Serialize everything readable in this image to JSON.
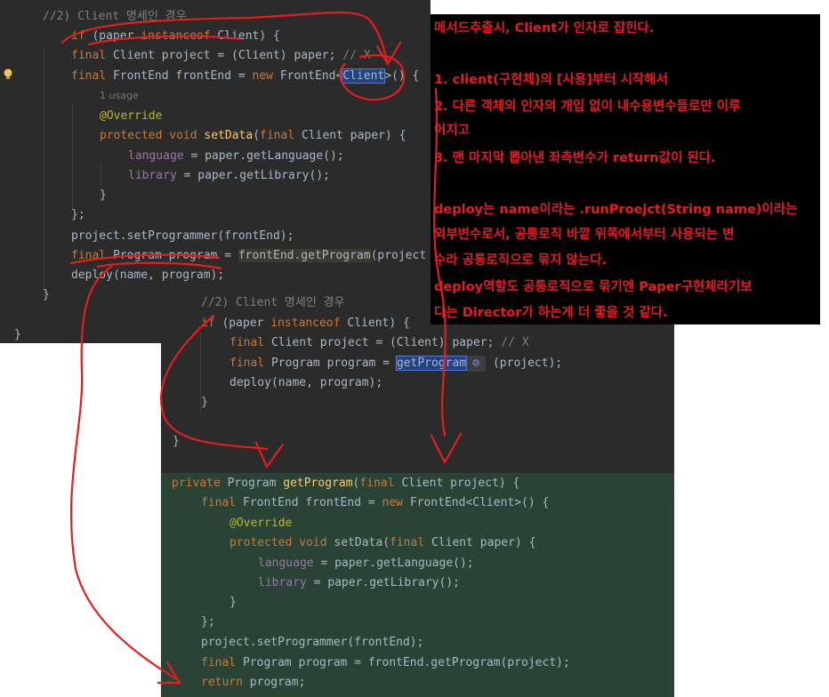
{
  "editor_top": {
    "lines": [
      {
        "id": "t1",
        "parts": [
          {
            "c": "cm",
            "t": "//2) Client 명세인 경우"
          }
        ]
      },
      {
        "id": "t2",
        "parts": [
          {
            "c": "kw",
            "t": "if"
          },
          {
            "c": "st",
            "t": " (paper "
          },
          {
            "c": "kw",
            "t": "instanceof"
          },
          {
            "c": "st",
            "t": " Client) {"
          }
        ]
      },
      {
        "id": "t3",
        "parts": [
          {
            "c": "kw",
            "t": "final"
          },
          {
            "c": "st",
            "t": " Client project = (Client) paper; "
          },
          {
            "c": "cm",
            "t": "// X"
          }
        ]
      },
      {
        "id": "t4",
        "parts": [
          {
            "c": "kw",
            "t": "final"
          },
          {
            "c": "st",
            "t": " FrontEnd frontEnd = "
          },
          {
            "c": "kw",
            "t": "new"
          },
          {
            "c": "st",
            "t": " FrontEnd<"
          },
          {
            "c": "sel",
            "t": "Client"
          },
          {
            "c": "st",
            "t": ">() {"
          }
        ]
      },
      {
        "id": "t5",
        "usage": "1 usage"
      },
      {
        "id": "t6",
        "parts": [
          {
            "c": "an",
            "t": "@Override"
          }
        ]
      },
      {
        "id": "t7",
        "parts": [
          {
            "c": "kw",
            "t": "protected void"
          },
          {
            "c": "st",
            "t": " "
          },
          {
            "c": "fn",
            "t": "setData"
          },
          {
            "c": "st",
            "t": "("
          },
          {
            "c": "kw",
            "t": "final"
          },
          {
            "c": "st",
            "t": " Client paper) {"
          }
        ]
      },
      {
        "id": "t8",
        "parts": [
          {
            "c": "fd",
            "t": "language"
          },
          {
            "c": "st",
            "t": " = paper.getLanguage();"
          }
        ]
      },
      {
        "id": "t9",
        "parts": [
          {
            "c": "fd",
            "t": "library"
          },
          {
            "c": "st",
            "t": " = paper.getLibrary();"
          }
        ]
      },
      {
        "id": "t10",
        "parts": [
          {
            "c": "st",
            "t": "}"
          }
        ]
      },
      {
        "id": "t11",
        "parts": [
          {
            "c": "st",
            "t": "};"
          }
        ]
      },
      {
        "id": "t12",
        "parts": [
          {
            "c": "st",
            "t": "project.setProgrammer(frontEnd);"
          }
        ]
      },
      {
        "id": "t13",
        "parts": [
          {
            "c": "kw",
            "t": "final"
          },
          {
            "c": "st",
            "t": " Program program = "
          },
          {
            "c": "warn",
            "t": "frontEnd.getProgram"
          },
          {
            "c": "st",
            "t": "(project"
          }
        ]
      },
      {
        "id": "t14",
        "parts": [
          {
            "c": "st",
            "t": "deploy(name, program);"
          }
        ]
      },
      {
        "id": "t15",
        "parts": [
          {
            "c": "st",
            "t": "}"
          }
        ]
      },
      {
        "id": "t16",
        "parts": [
          {
            "c": "st",
            "t": "}"
          }
        ]
      }
    ]
  },
  "editor_mid": {
    "lines": [
      {
        "id": "m1",
        "parts": [
          {
            "c": "cm",
            "t": "//2) Client 명세인 경우"
          }
        ]
      },
      {
        "id": "m2",
        "parts": [
          {
            "c": "kw",
            "t": "if"
          },
          {
            "c": "st",
            "t": " (paper "
          },
          {
            "c": "kw",
            "t": "instanceof"
          },
          {
            "c": "st",
            "t": " Client) {"
          }
        ]
      },
      {
        "id": "m3",
        "parts": [
          {
            "c": "kw",
            "t": "final"
          },
          {
            "c": "st",
            "t": " Client project = (Client) paper; "
          },
          {
            "c": "cm",
            "t": "// X"
          }
        ]
      },
      {
        "id": "m4",
        "parts": [
          {
            "c": "kw",
            "t": "final"
          },
          {
            "c": "st",
            "t": " Program program = "
          },
          {
            "c": "sel",
            "t": "getProgram"
          },
          {
            "c": "gear",
            "t": "⚙"
          },
          {
            "c": "st",
            "t": " (project);"
          }
        ]
      },
      {
        "id": "m5",
        "parts": [
          {
            "c": "st",
            "t": "deploy(name, program);"
          }
        ]
      },
      {
        "id": "m6",
        "parts": [
          {
            "c": "st",
            "t": "}"
          }
        ]
      },
      {
        "id": "m7",
        "parts": [
          {
            "c": "st",
            "t": "}"
          }
        ]
      }
    ]
  },
  "editor_bottom": {
    "lines": [
      {
        "id": "b1",
        "parts": [
          {
            "c": "kw",
            "t": "private"
          },
          {
            "c": "st",
            "t": " Program "
          },
          {
            "c": "fn",
            "t": "getProgram"
          },
          {
            "c": "st",
            "t": "("
          },
          {
            "c": "kw",
            "t": "final"
          },
          {
            "c": "st",
            "t": " Client project) {"
          }
        ]
      },
      {
        "id": "b2",
        "parts": [
          {
            "c": "kw",
            "t": "final"
          },
          {
            "c": "st",
            "t": " FrontEnd frontEnd = "
          },
          {
            "c": "kw",
            "t": "new"
          },
          {
            "c": "st",
            "t": " FrontEnd<Client>() {"
          }
        ]
      },
      {
        "id": "b3",
        "parts": [
          {
            "c": "an",
            "t": "@Override"
          }
        ]
      },
      {
        "id": "b4",
        "parts": [
          {
            "c": "kw",
            "t": "protected void"
          },
          {
            "c": "st",
            "t": " setData("
          },
          {
            "c": "kw",
            "t": "final"
          },
          {
            "c": "st",
            "t": " Client paper) {"
          }
        ]
      },
      {
        "id": "b5",
        "parts": [
          {
            "c": "fd",
            "t": "language"
          },
          {
            "c": "st",
            "t": " = paper.getLanguage();"
          }
        ]
      },
      {
        "id": "b6",
        "parts": [
          {
            "c": "fd",
            "t": "library"
          },
          {
            "c": "st",
            "t": " = paper.getLibrary();"
          }
        ]
      },
      {
        "id": "b7",
        "parts": [
          {
            "c": "st",
            "t": "}"
          }
        ]
      },
      {
        "id": "b8",
        "parts": [
          {
            "c": "st",
            "t": "};"
          }
        ]
      },
      {
        "id": "b9",
        "parts": [
          {
            "c": "st",
            "t": "project.setProgrammer(frontEnd);"
          }
        ]
      },
      {
        "id": "b10",
        "parts": [
          {
            "c": "kw",
            "t": "final"
          },
          {
            "c": "st",
            "t": " Program program = frontEnd.getProgram(project);"
          }
        ]
      },
      {
        "id": "b11",
        "parts": [
          {
            "c": "kw",
            "t": "return"
          },
          {
            "c": "st",
            "t": " program;"
          }
        ]
      }
    ]
  },
  "note": {
    "lines": [
      "메서드추출시, Client가 인자로 잡힌다.",
      "",
      "1. client(구현체)의 [사용]부터 시작해서",
      "2. 다른 객체의 인자의 개입 없이 내수용변수들로만 이루",
      "어지고",
      "3. 맨 마지막 뽑아낸 좌측변수가 return값이 된다.",
      "",
      "deploy는 name이라는 .runProejct(String name)이라는",
      "외부변수로서,  공통로직 바깥 위쪽에서부터 사용되는 변",
      "수라 공통로직으로 묶지 않는다.",
      "deploy역할도 공통로직으로 묶기엔 Paper구현체라기보",
      "다는 Director가 하는게 더 좋을 것 같다."
    ]
  },
  "colors": {
    "editor_bg": "#2b2b2b",
    "extracted_bg": "#294436",
    "annotation_red": "#e31e1e",
    "keyword": "#cc7832",
    "method": "#ffc66d",
    "field": "#9876aa"
  }
}
